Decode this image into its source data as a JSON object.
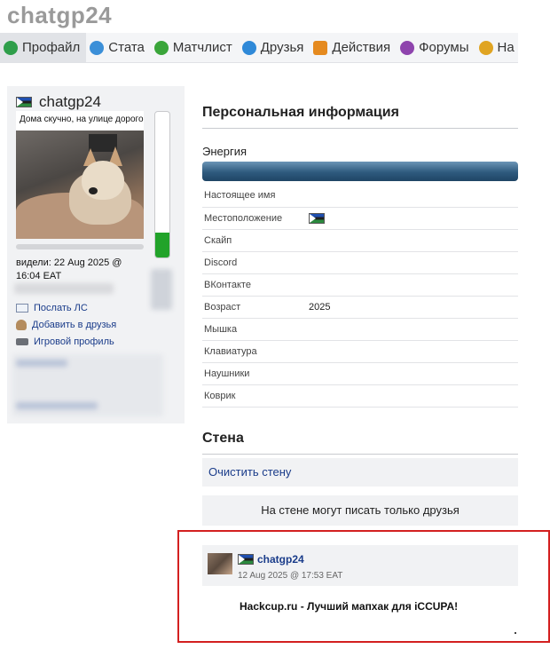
{
  "site": {
    "title": "chatgp24"
  },
  "nav": [
    {
      "label": "Профайл",
      "icon": "profile-icon",
      "color": "#2e9e4a"
    },
    {
      "label": "Стата",
      "icon": "stats-icon",
      "color": "#3b8fd8"
    },
    {
      "label": "Матчлист",
      "icon": "matchlist-icon",
      "color": "#3aa53a"
    },
    {
      "label": "Друзья",
      "icon": "friends-icon",
      "color": "#2f89d8"
    },
    {
      "label": "Действия",
      "icon": "actions-icon",
      "color": "#e58a1f"
    },
    {
      "label": "Форумы",
      "icon": "forums-icon",
      "color": "#8e44ad"
    },
    {
      "label": "На",
      "icon": "rewards-icon",
      "color": "#e0a422"
    }
  ],
  "profile": {
    "username": "chatgp24",
    "status": "Дома скучно, на улице дорого",
    "seen": "видели: 22 Aug 2025 @ 16:04 EAT",
    "gauge_fraction": 0.17,
    "links": [
      {
        "label": "Послать ЛС",
        "icon": "mail-icon"
      },
      {
        "label": "Добавить в друзья",
        "icon": "add-friend-icon"
      },
      {
        "label": "Игровой профиль",
        "icon": "game-profile-icon"
      }
    ]
  },
  "personal": {
    "title": "Персональная информация",
    "energy_label": "Энергия",
    "fields": [
      {
        "key": "Настоящее имя",
        "value": ""
      },
      {
        "key": "Местоположение",
        "value": ""
      },
      {
        "key": "Скайп",
        "value": ""
      },
      {
        "key": "Discord",
        "value": ""
      },
      {
        "key": "ВКонтакте",
        "value": ""
      },
      {
        "key": "Возраст",
        "value": "2025"
      },
      {
        "key": "Мышка",
        "value": ""
      },
      {
        "key": "Клавиатура",
        "value": ""
      },
      {
        "key": "Наушники",
        "value": ""
      },
      {
        "key": "Коврик",
        "value": ""
      }
    ]
  },
  "wall": {
    "title": "Стена",
    "clear_label": "Очистить стену",
    "note": "На стене могут писать только друзья",
    "post": {
      "author": "chatgp24",
      "date": "12 Aug 2025 @ 17:53 EAT",
      "text": "Hackcup.ru - Лучший мапхак для iCCUPA!"
    }
  },
  "colors": {
    "link": "#1a3c8a",
    "energy": "#2e5a7e",
    "gauge": "#22a32a",
    "highlight": "#d32020"
  }
}
